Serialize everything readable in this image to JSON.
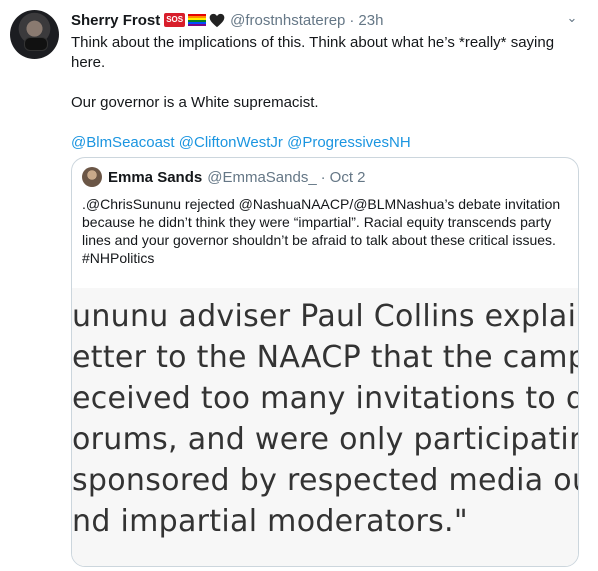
{
  "tweet": {
    "name": "Sherry Frost",
    "badge_sos": "SOS",
    "handle": "@frostnhstaterep",
    "separator": "·",
    "time": "23h",
    "caret": "⌄",
    "text_line1": "Think about the implications of this.  Think about what he’s *really* saying here.",
    "text_line2": "Our governor is a White supremacist.",
    "mentions": [
      "@BlmSeacoast",
      "@CliftonWestJr",
      "@ProgressivesNH"
    ]
  },
  "quote": {
    "name": "Emma Sands",
    "handle": "@EmmaSands_",
    "separator": "·",
    "date": "Oct 2",
    "text": ".@ChrisSununu rejected @NashuaNAACP/@BLMNashua’s debate invitation because he didn’t think they were “impartial”. Racial equity transcends party lines and your governor shouldn’t be afraid to talk about these critical issues. #NHPolitics",
    "image_lines": [
      "ununu adviser Paul Collins explained th",
      "etter to the NAACP that the campaign h",
      "eceived too many invitations to debates",
      "orums, and were only participating in th",
      "sponsored by respected media outlets w",
      "nd impartial moderators.\""
    ]
  },
  "colors": {
    "link": "#1b95e0",
    "muted": "#657786",
    "border": "#ccd6dd",
    "sos_badge": "#d81e2b"
  },
  "icons": [
    "sos-badge-icon",
    "rainbow-flag-icon",
    "black-heart-icon",
    "caret-down-icon"
  ]
}
